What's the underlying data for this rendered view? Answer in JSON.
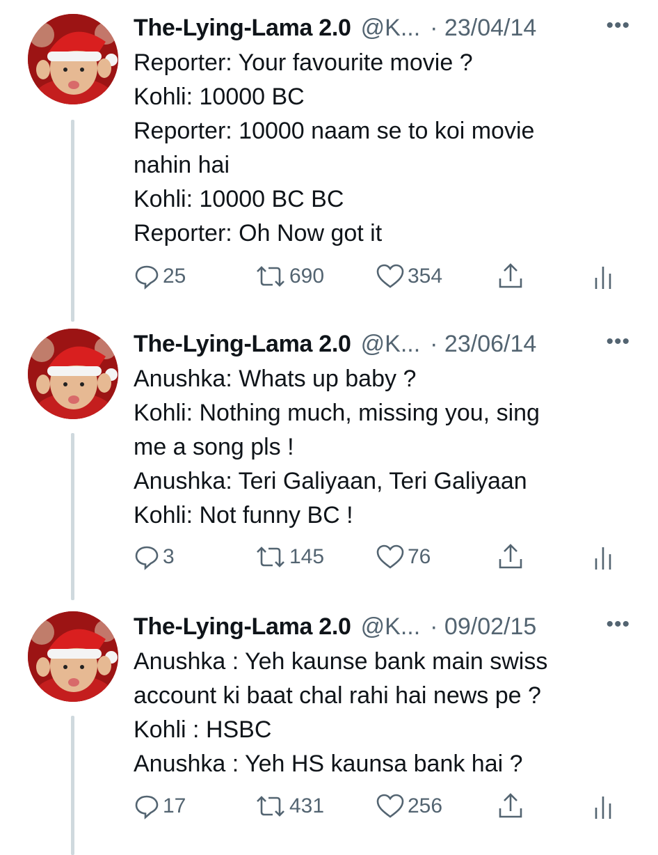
{
  "tweets": [
    {
      "name": "The-Lying-Lama 2.0",
      "handle": "@K...",
      "date": "· 23/04/14",
      "more": "•••",
      "lines": [
        "Reporter: Your favourite movie ?",
        "Kohli: 10000 BC",
        "Reporter: 10000 naam se to koi movie",
        "nahin hai",
        "Kohli: 10000 BC BC",
        "Reporter: Oh Now got it"
      ],
      "replies": "25",
      "retweets": "690",
      "likes": "354"
    },
    {
      "name": "The-Lying-Lama 2.0",
      "handle": "@K...",
      "date": "· 23/06/14",
      "more": "•••",
      "lines": [
        "Anushka: Whats up baby ?",
        "Kohli: Nothing much, missing you, sing",
        "me a song pls !",
        "Anushka: Teri Galiyaan, Teri Galiyaan",
        "Kohli: Not funny BC !"
      ],
      "replies": "3",
      "retweets": "145",
      "likes": "76"
    },
    {
      "name": "The-Lying-Lama 2.0",
      "handle": "@K...",
      "date": "· 09/02/15",
      "more": "•••",
      "lines": [
        "Anushka : Yeh kaunse bank main swiss",
        "account ki baat chal rahi hai news pe ?",
        "Kohli : HSBC",
        "Anushka : Yeh HS kaunsa bank hai ?"
      ],
      "replies": "17",
      "retweets": "431",
      "likes": "256"
    }
  ],
  "icons": {
    "reply": "reply-icon",
    "retweet": "retweet-icon",
    "like": "heart-icon",
    "share": "share-icon",
    "analytics": "analytics-icon"
  },
  "colors": {
    "text": "#0f1419",
    "secondary": "#536471",
    "thread_line": "#cfd9de",
    "avatar_red": "#c41e1e"
  }
}
